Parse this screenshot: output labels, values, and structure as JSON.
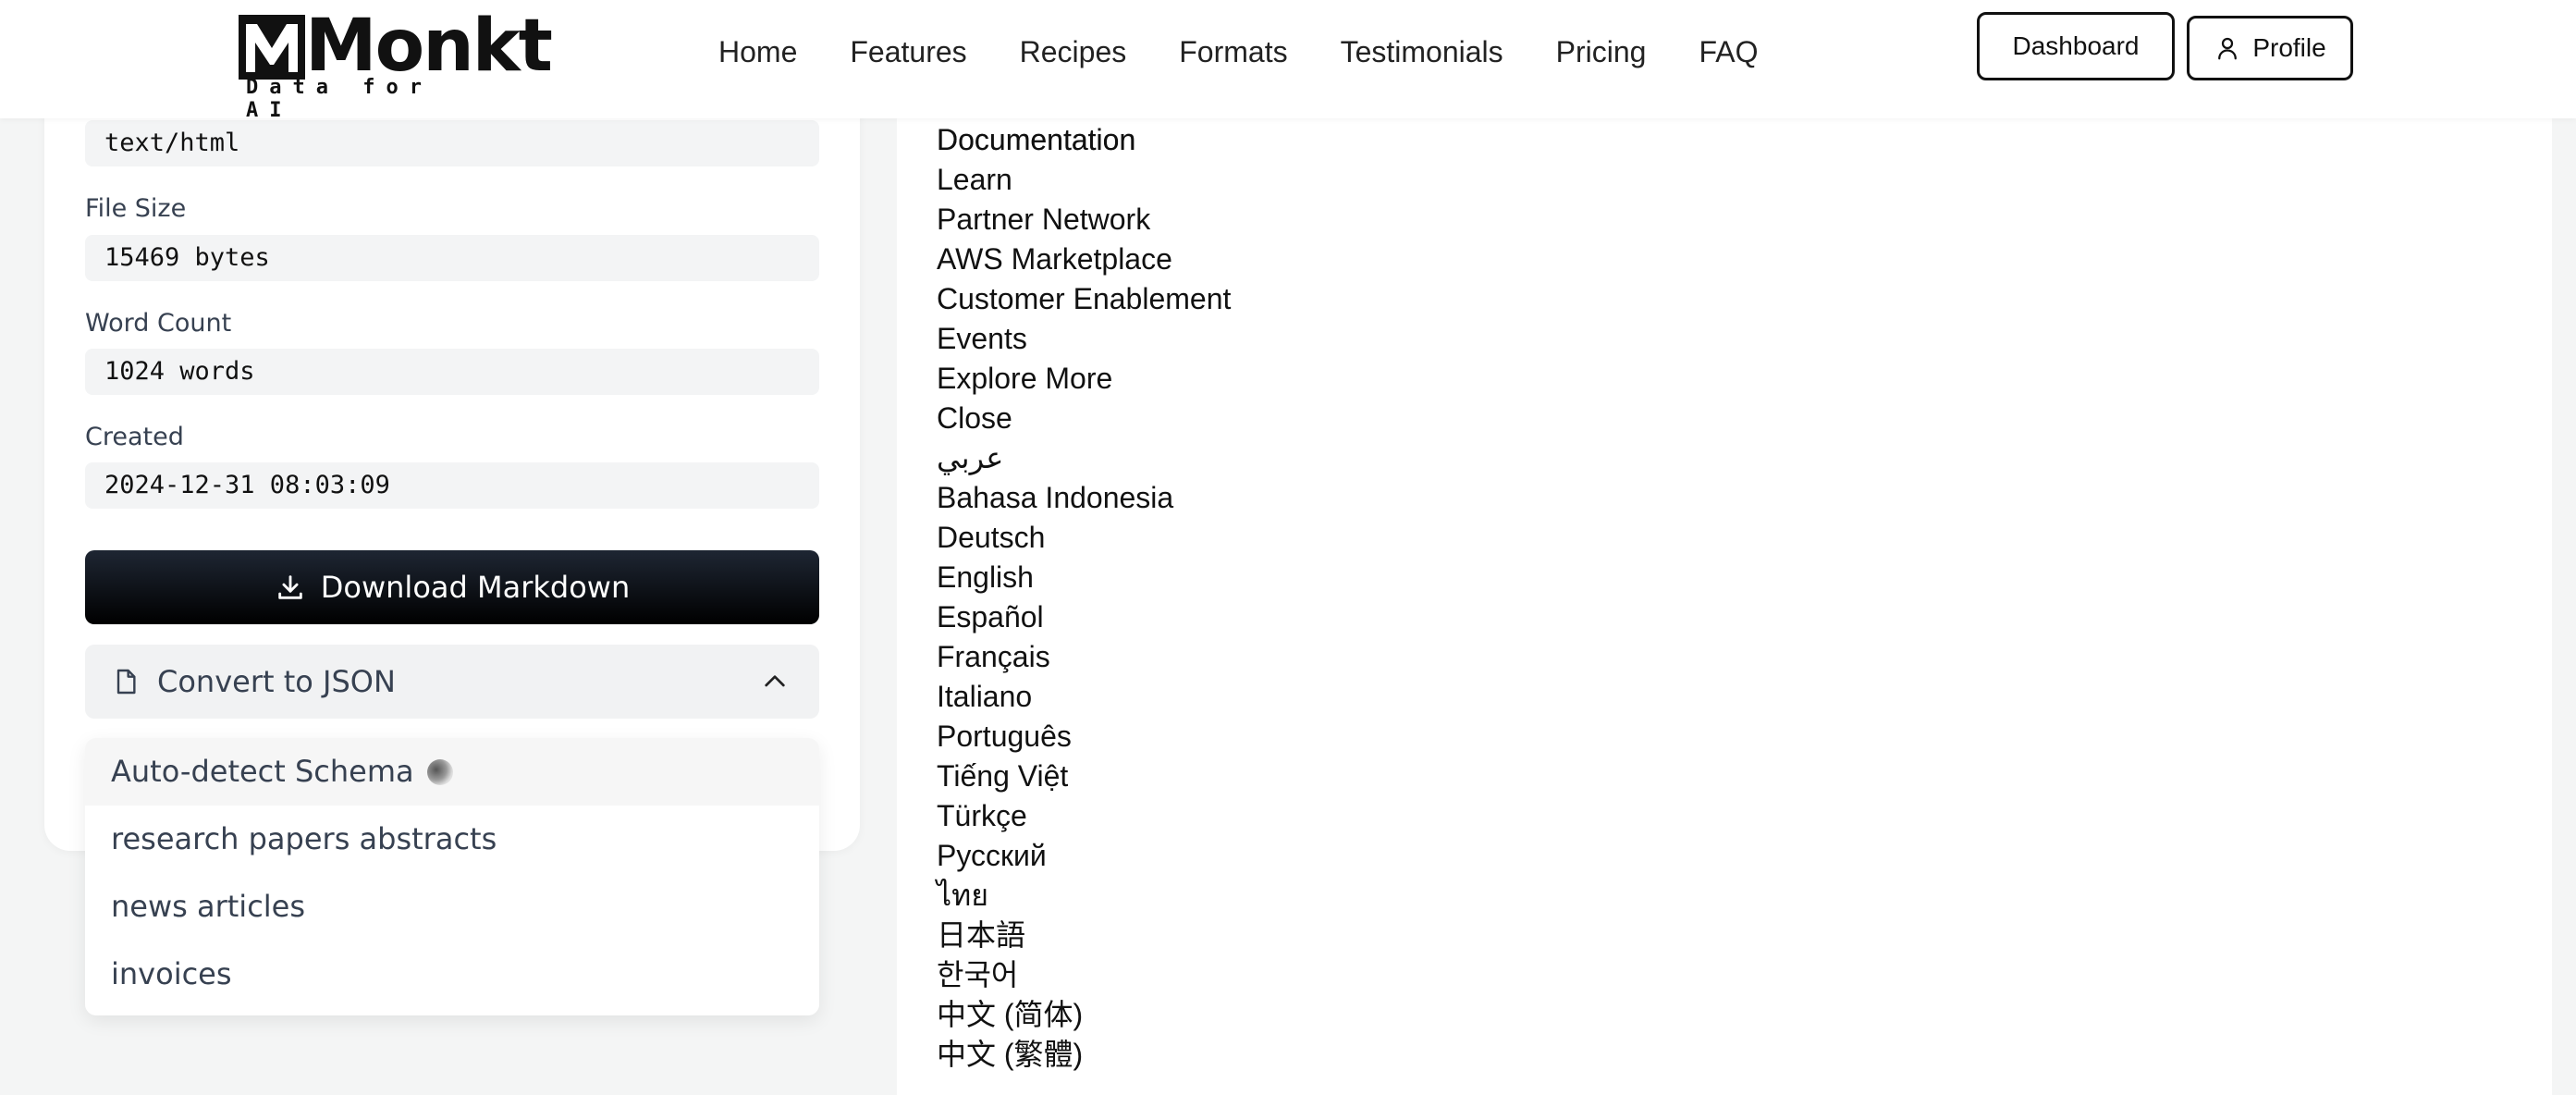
{
  "header": {
    "logo_text": "Monkt",
    "logo_tagline": "Data for AI",
    "nav": [
      "Home",
      "Features",
      "Recipes",
      "Formats",
      "Testimonials",
      "Pricing",
      "FAQ"
    ],
    "dashboard_label": "Dashboard",
    "profile_label": "Profile"
  },
  "metadata": {
    "mime_value": "text/html",
    "file_size_label": "File Size",
    "file_size_value": "15469 bytes",
    "word_count_label": "Word Count",
    "word_count_value": "1024 words",
    "created_label": "Created",
    "created_value": "2024-12-31 08:03:09"
  },
  "actions": {
    "download_label": "Download Markdown",
    "convert_label": "Convert to JSON"
  },
  "schema_dropdown": {
    "items": [
      "Auto-detect Schema",
      "research papers abstracts",
      "news articles",
      "invoices"
    ]
  },
  "right_menu": {
    "items": [
      "Documentation",
      "Learn",
      "Partner Network",
      "AWS Marketplace",
      "Customer Enablement",
      "Events",
      "Explore More",
      "Close",
      "عربي",
      "Bahasa Indonesia",
      "Deutsch",
      "English",
      "Español",
      "Français",
      "Italiano",
      "Português",
      "Tiếng Việt",
      "Türkçe",
      "Русский",
      "ไทย",
      "日本語",
      "한국어",
      "中文 (简体)",
      "中文 (繁體)"
    ]
  }
}
